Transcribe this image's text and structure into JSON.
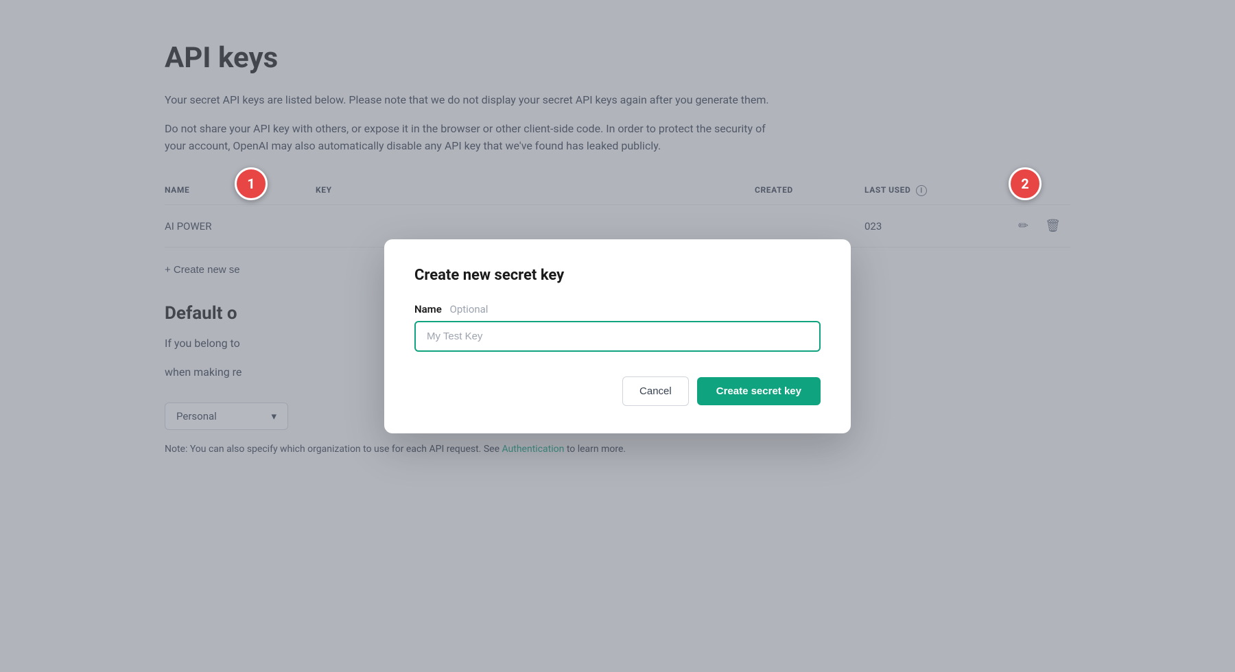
{
  "page": {
    "title": "API keys",
    "description1": "Your secret API keys are listed below. Please note that we do not display your secret API keys again after you generate them.",
    "description2": "Do not share your API key with others, or expose it in the browser or other client-side code. In order to protect the security of your account, OpenAI may also automatically disable any API key that we've found has leaked publicly.",
    "table": {
      "headers": [
        "NAME",
        "KEY",
        "CREATED",
        "LAST USED"
      ],
      "rows": [
        {
          "name": "AI POWER",
          "key": "",
          "created": "",
          "last_used": "023"
        }
      ]
    },
    "create_new_label": "+ Create new se",
    "default_org_title": "Default o",
    "default_org_description": "If you belong to",
    "default_org_description2": "when making re",
    "select_value": "Personal",
    "note_text": "Note: You can also specify which organization to use for each API request. See",
    "note_link": "Authentication",
    "note_text2": "to learn more."
  },
  "modal": {
    "title": "Create new secret key",
    "field_label": "Name",
    "field_optional": "Optional",
    "input_placeholder": "My Test Key",
    "cancel_label": "Cancel",
    "create_label": "Create secret key"
  },
  "annotations": {
    "bubble1": "1",
    "bubble2": "2"
  }
}
